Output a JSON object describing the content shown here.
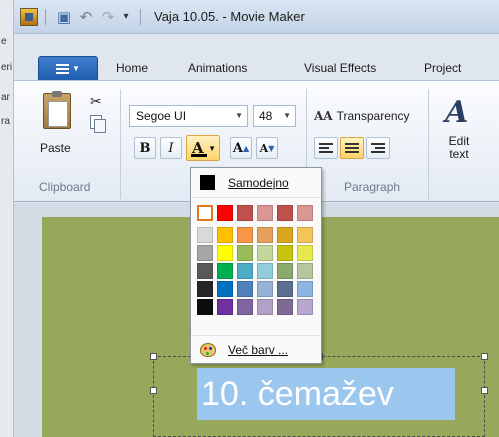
{
  "background_window": {
    "letters": [
      "e",
      "eri",
      "ar",
      "ra"
    ]
  },
  "titlebar": {
    "title": "Vaja 10.05. - Movie Maker"
  },
  "tabs": [
    "Home",
    "Animations",
    "Visual Effects",
    "Project"
  ],
  "ribbon": {
    "clipboard": {
      "paste_label": "Paste",
      "group_label": "Clipboard"
    },
    "font": {
      "font_name": "Segoe UI",
      "font_size": "48",
      "bold_label": "B",
      "italic_label": "I",
      "font_color_label": "A",
      "grow_label": "A",
      "shrink_label": "A"
    },
    "paragraph": {
      "transparency_glyph": "AA",
      "transparency_label": "Transparency",
      "group_label": "Paragraph"
    },
    "edit_text": {
      "icon": "A",
      "label_line1": "Edit",
      "label_line2": "text"
    }
  },
  "color_picker": {
    "automatic_label": "Samodejno",
    "automatic_color": "#000000",
    "more_colors_label": "Več barv ...",
    "columns": [
      [
        "#ffffff",
        "#d9d9d9",
        "#a6a6a6",
        "#595959",
        "#262626",
        "#0d0d0d"
      ],
      [
        "#ff0000",
        "#ffc000",
        "#ffff00",
        "#00b050",
        "#0070c0",
        "#7030a0"
      ],
      [
        "#c0504d",
        "#f79646",
        "#9bbb59",
        "#4bacc6",
        "#4f81bd",
        "#8064a2"
      ],
      [
        "#d99694",
        "#e5a05c",
        "#c3d69b",
        "#93cddd",
        "#95b3d7",
        "#b2a1c7"
      ],
      [
        "#c0504d",
        "#d8a71f",
        "#c6c50e",
        "#8aa96a",
        "#5b6f92",
        "#7d6b96"
      ],
      [
        "#d99694",
        "#f2c45c",
        "#e6e94d",
        "#b6c79d",
        "#8eb4e3",
        "#b7a6cf"
      ]
    ],
    "selected": [
      0,
      0
    ]
  },
  "caption": {
    "text": "10. čemažev"
  },
  "colors": {
    "video_background": "#97a85c",
    "caption_highlight": "#9bc7ee",
    "file_tab": "#2a68bc"
  }
}
